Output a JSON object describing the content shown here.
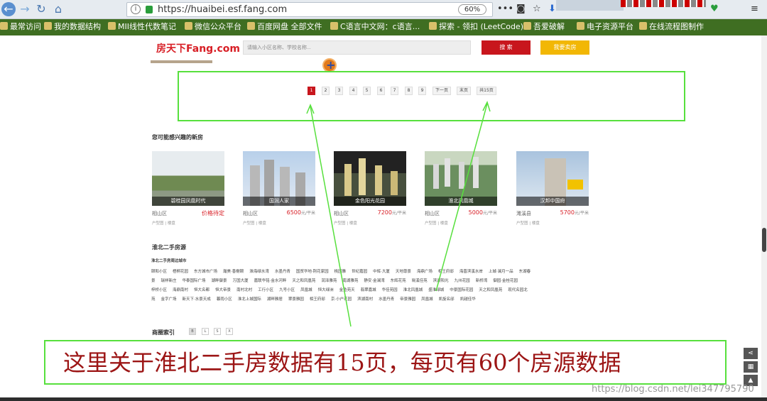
{
  "browser": {
    "url": "https://huaibei.esf.fang.com",
    "zoom": "60%",
    "info_icon": "info-icon",
    "secure_icon": "lock-icon"
  },
  "bookmarks": [
    "最常访问",
    "我的数据结构",
    "MII线性代数笔记",
    "微信公众平台",
    "百度网盘 全部文件",
    "C语言中文网：c语言...",
    "探索 - 领扣 (LeetCode)",
    "吾爱破解",
    "电子资源平台",
    "在线流程图制作"
  ],
  "site": {
    "logo": "房天下Fang.com",
    "search_placeholder": "请输入小区名称、学校名称...",
    "search_button": "搜 索",
    "sell_button": "我要卖房"
  },
  "pager": {
    "pages": [
      "1",
      "2",
      "3",
      "4",
      "5",
      "6",
      "7",
      "8",
      "9"
    ],
    "active": "1",
    "next": "下一页",
    "last": "末页",
    "total": "共15页"
  },
  "new_homes": {
    "title": "您可能感兴趣的新房",
    "items": [
      {
        "name": "碧桂园凤凰时代",
        "district": "相山区",
        "price": "价格待定",
        "unit": "",
        "links": "户型图 | 楼盘",
        "color": "#6f8a52"
      },
      {
        "name": "国润人家",
        "district": "相山区",
        "price": "6500",
        "unit": "元/平米",
        "links": "户型图 | 楼盘",
        "color": "#9fb8d6"
      },
      {
        "name": "金色阳光花园",
        "district": "相山区",
        "price": "7200",
        "unit": "元/平米",
        "links": "户型图 | 楼盘",
        "color": "#3d3d44"
      },
      {
        "name": "淮北凤凰城",
        "district": "相山区",
        "price": "5000",
        "unit": "元/平米",
        "links": "户型图 | 楼盘",
        "color": "#6b8f5f"
      },
      {
        "name": "汉邦中国府",
        "district": "濉溪县",
        "price": "5700",
        "unit": "元/平米",
        "links": "户型图 | 楼盘",
        "color": "#a9bfd6"
      }
    ]
  },
  "second_hand": {
    "title": "淮北二手房源",
    "subtitle": "淮北二手房周边城市",
    "rows": [
      [
        "颐和小区",
        "梧桐花园",
        "东方城市广场",
        "瀚美·香榭颐",
        "淮海绿水湾",
        "水墨丹青",
        "国贸华地·荆花家园",
        "桃园雅",
        "世纪嘉园",
        "中辉·大厦",
        "天地尊景",
        "海鼎广场",
        "相王府邸",
        "海晋滨溪水岸",
        "上城·澜月一品",
        "东湖春"
      ],
      [
        "景",
        "瑞祥新庄",
        "华泰国际广场",
        "湖畔御景",
        "万国大厦",
        "嘉联华铭·金水河畔",
        "天之和凤凰苑",
        "润泽雅苑",
        "南湖雅苑",
        "静安·金澜湾",
        "东辉花苑",
        "晓溪佳苑",
        "滨湖阳光",
        "九州花园",
        "新桥湾",
        "御园·金桂花园"
      ],
      [
        "梓桥小区",
        "海鼎南村",
        "恒大名都",
        "恒大帝景",
        "南村北村",
        "工行小区",
        "九号小区",
        "凤凰城",
        "恒大绿洲",
        "金鱼苑天",
        "翡翠嘉城",
        "华佳苑园",
        "淮北凤凰城",
        "盛淮绿城",
        "中豪国际花园",
        "天之和凤凰苑",
        "现代名园北"
      ],
      [
        "苑",
        "金字广场",
        "新天下·水景天成",
        "暮雨小区",
        "淮北上城国际",
        "湖畔雅居",
        "翠景雅园",
        "相王府邸",
        "京·小户花园",
        "滨湖南村",
        "水墨丹青",
        "帝景雅园",
        "凤凰城",
        "凯旋名邸",
        "凯越佳华"
      ]
    ]
  },
  "index": {
    "title": "商圈索引",
    "letters": [
      "B",
      "L",
      "S",
      "X"
    ]
  },
  "annotation": "这里关于淮北二手房数据有15页，每页有60个房源数据",
  "watermark": "https://blog.csdn.net/lei347795790",
  "colors": {
    "brand_red": "#c8161d",
    "sell_yellow": "#f2b705",
    "highlight_green": "#57e03d",
    "annotation_text": "#9c1515",
    "bookmark_bar": "#3f6e22"
  }
}
